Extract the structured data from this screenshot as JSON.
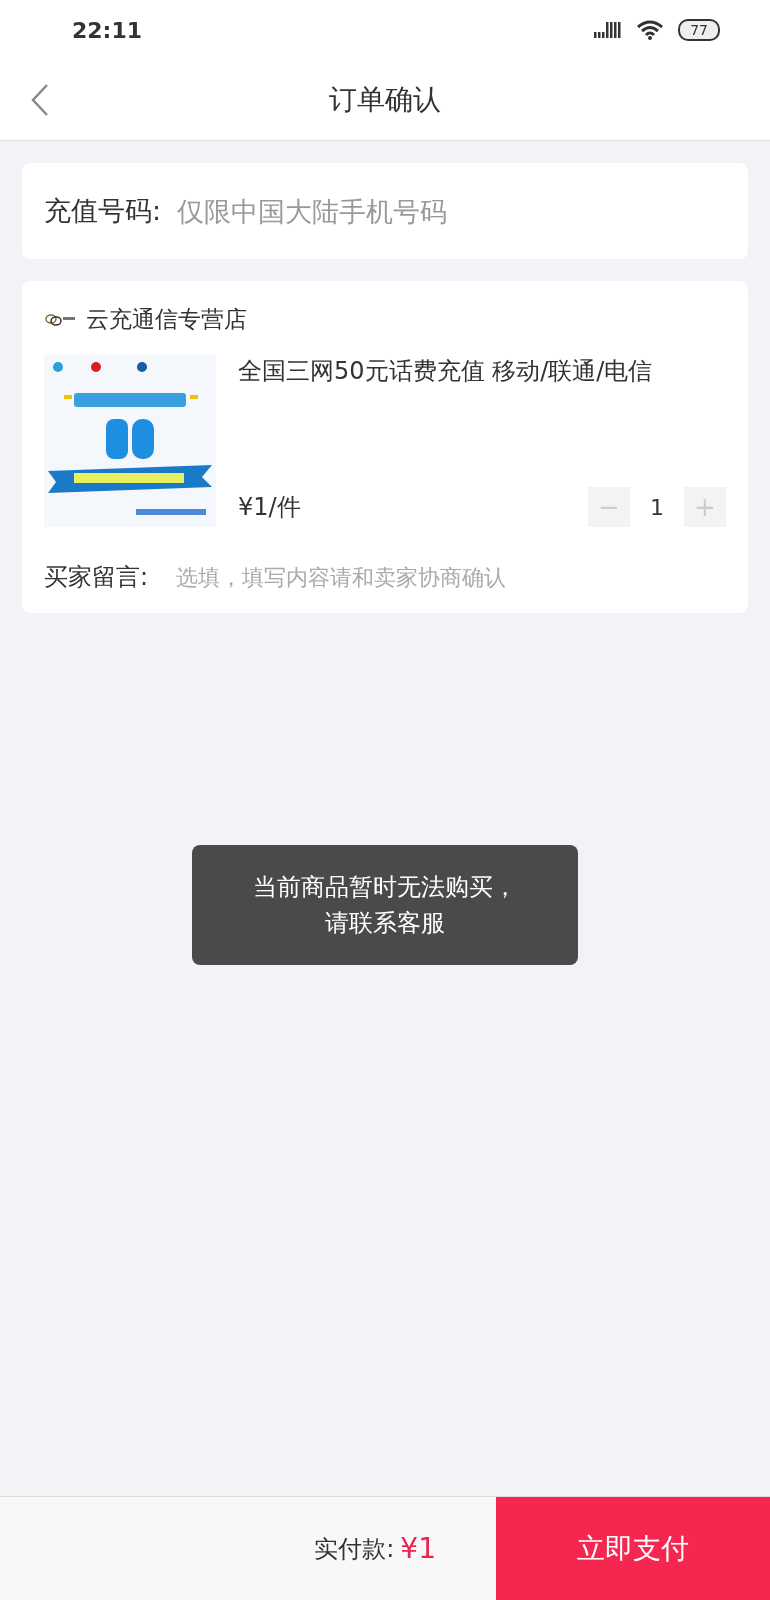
{
  "status_bar": {
    "time": "22:11",
    "battery": "77"
  },
  "header": {
    "title": "订单确认"
  },
  "phone_field": {
    "label": "充值号码:",
    "placeholder": "仅限中国大陆手机号码"
  },
  "order": {
    "shop_name": "云充通信专营店",
    "product": {
      "title": "全国三网50元话费充值 移动/联通/电信",
      "price": "¥1/件",
      "quantity": "1",
      "minus": "−",
      "plus": "+",
      "minus_disabled": true,
      "plus_disabled": true
    },
    "message": {
      "label": "买家留言:",
      "placeholder": "选填，填写内容请和卖家协商确认"
    }
  },
  "toast": {
    "lines": [
      "当前商品暂时无法购买，",
      "请联系客服"
    ]
  },
  "footer": {
    "total_label": "实付款:",
    "total": "¥1",
    "pay_button": "立即支付"
  }
}
